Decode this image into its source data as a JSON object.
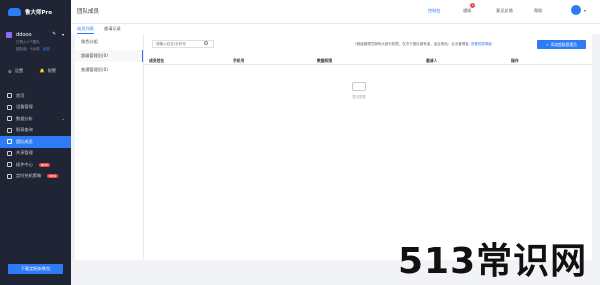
{
  "brand": {
    "name": "鲁大师Pro"
  },
  "account": {
    "name": "ddooo",
    "plan": "已购入1个团队",
    "meta_left": "团队版 · 5台机",
    "renew": "续费"
  },
  "tools": {
    "settings": "设置",
    "alerts": "报警"
  },
  "nav": [
    {
      "label": "首页",
      "icon": "home-icon"
    },
    {
      "label": "设备管理",
      "icon": "device-icon"
    },
    {
      "label": "数据分析",
      "icon": "chart-icon"
    },
    {
      "label": "报表查询",
      "icon": "report-icon"
    },
    {
      "label": "团队成员",
      "icon": "team-icon",
      "active": true
    },
    {
      "label": "共享管理",
      "icon": "share-icon"
    },
    {
      "label": "插件中心",
      "icon": "plugin-icon",
      "badge": "NEW"
    },
    {
      "label": "定时关机策略",
      "icon": "clock-icon",
      "badge": "NEW"
    }
  ],
  "download_button": "下载定制安装包",
  "topbar": {
    "title": "团队成员",
    "links": [
      "控制台",
      "通知",
      "意见反馈",
      "帮助"
    ],
    "notification_count": "1"
  },
  "subnav": {
    "tabs": [
      "成员列表",
      "邀请记录"
    ]
  },
  "roles": [
    "角色分组",
    "超级管理员(0)",
    "普通管理员(0)"
  ],
  "search": {
    "placeholder": "请输入姓名/手机号"
  },
  "hint": {
    "text": "*超级管理员拥有大部分权限，仅次于团队拥有者，适合角色：企业管理者",
    "link": "查看权限明细"
  },
  "add_button": "+ 添加超级管理员",
  "table": {
    "columns": [
      "成员姓名",
      "手机号",
      "数据权限",
      "邀请人",
      "操作"
    ]
  },
  "empty": {
    "text": "暂无数据"
  },
  "watermark": "513常识网",
  "colors": {
    "accent": "#2f7bf5",
    "sidebar_bg": "#1f2535"
  }
}
